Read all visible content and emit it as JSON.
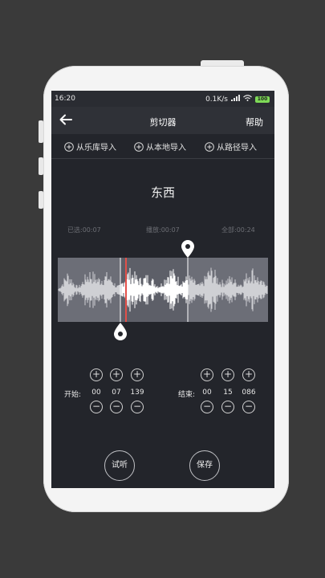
{
  "status": {
    "time": "16:20",
    "speed": "0.1K/s",
    "battery": "100"
  },
  "header": {
    "title": "剪切器",
    "help": "帮助"
  },
  "imports": [
    {
      "label": "从乐库导入"
    },
    {
      "label": "从本地导入"
    },
    {
      "label": "从路径导入"
    }
  ],
  "song": {
    "name": "东西"
  },
  "times": {
    "selected": "已选:00:07",
    "played": "播放:00:07",
    "total": "全部:00:24"
  },
  "start": {
    "label": "开始:",
    "values": [
      "00",
      "07",
      "139"
    ]
  },
  "end": {
    "label": "结束:",
    "values": [
      "00",
      "15",
      "086"
    ]
  },
  "buttons": {
    "preview": "试听",
    "save": "保存"
  },
  "colors": {
    "playhead": "#e2504a",
    "accent_battery": "#7ed957"
  }
}
